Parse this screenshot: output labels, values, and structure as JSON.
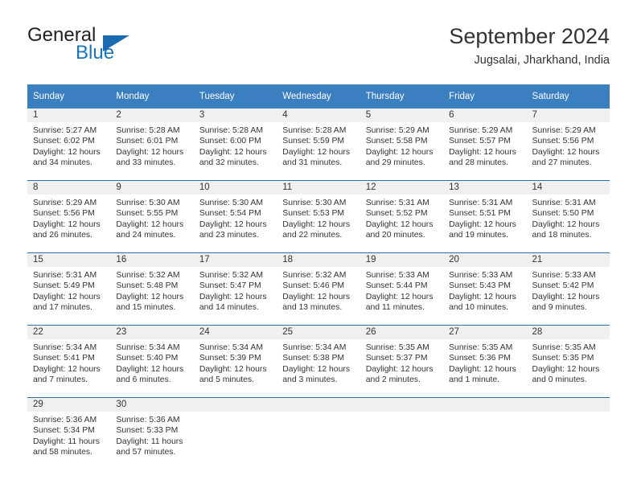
{
  "brand": {
    "name_top": "General",
    "name_bottom": "Blue",
    "triangle_icon": "blue-triangle-icon",
    "color_dark": "#231f20",
    "color_blue": "#1a74bb"
  },
  "header": {
    "title": "September 2024",
    "subtitle": "Jugsalai, Jharkhand, India"
  },
  "colors": {
    "header_band": "#3c7fc1",
    "row_divider": "#2e6fb0",
    "daynum_band": "#f0f0f0",
    "text": "#333333"
  },
  "weekdays": [
    "Sunday",
    "Monday",
    "Tuesday",
    "Wednesday",
    "Thursday",
    "Friday",
    "Saturday"
  ],
  "weeks": [
    [
      {
        "day": "1",
        "sunrise": "Sunrise: 5:27 AM",
        "sunset": "Sunset: 6:02 PM",
        "daylight1": "Daylight: 12 hours",
        "daylight2": "and 34 minutes."
      },
      {
        "day": "2",
        "sunrise": "Sunrise: 5:28 AM",
        "sunset": "Sunset: 6:01 PM",
        "daylight1": "Daylight: 12 hours",
        "daylight2": "and 33 minutes."
      },
      {
        "day": "3",
        "sunrise": "Sunrise: 5:28 AM",
        "sunset": "Sunset: 6:00 PM",
        "daylight1": "Daylight: 12 hours",
        "daylight2": "and 32 minutes."
      },
      {
        "day": "4",
        "sunrise": "Sunrise: 5:28 AM",
        "sunset": "Sunset: 5:59 PM",
        "daylight1": "Daylight: 12 hours",
        "daylight2": "and 31 minutes."
      },
      {
        "day": "5",
        "sunrise": "Sunrise: 5:29 AM",
        "sunset": "Sunset: 5:58 PM",
        "daylight1": "Daylight: 12 hours",
        "daylight2": "and 29 minutes."
      },
      {
        "day": "6",
        "sunrise": "Sunrise: 5:29 AM",
        "sunset": "Sunset: 5:57 PM",
        "daylight1": "Daylight: 12 hours",
        "daylight2": "and 28 minutes."
      },
      {
        "day": "7",
        "sunrise": "Sunrise: 5:29 AM",
        "sunset": "Sunset: 5:56 PM",
        "daylight1": "Daylight: 12 hours",
        "daylight2": "and 27 minutes."
      }
    ],
    [
      {
        "day": "8",
        "sunrise": "Sunrise: 5:29 AM",
        "sunset": "Sunset: 5:56 PM",
        "daylight1": "Daylight: 12 hours",
        "daylight2": "and 26 minutes."
      },
      {
        "day": "9",
        "sunrise": "Sunrise: 5:30 AM",
        "sunset": "Sunset: 5:55 PM",
        "daylight1": "Daylight: 12 hours",
        "daylight2": "and 24 minutes."
      },
      {
        "day": "10",
        "sunrise": "Sunrise: 5:30 AM",
        "sunset": "Sunset: 5:54 PM",
        "daylight1": "Daylight: 12 hours",
        "daylight2": "and 23 minutes."
      },
      {
        "day": "11",
        "sunrise": "Sunrise: 5:30 AM",
        "sunset": "Sunset: 5:53 PM",
        "daylight1": "Daylight: 12 hours",
        "daylight2": "and 22 minutes."
      },
      {
        "day": "12",
        "sunrise": "Sunrise: 5:31 AM",
        "sunset": "Sunset: 5:52 PM",
        "daylight1": "Daylight: 12 hours",
        "daylight2": "and 20 minutes."
      },
      {
        "day": "13",
        "sunrise": "Sunrise: 5:31 AM",
        "sunset": "Sunset: 5:51 PM",
        "daylight1": "Daylight: 12 hours",
        "daylight2": "and 19 minutes."
      },
      {
        "day": "14",
        "sunrise": "Sunrise: 5:31 AM",
        "sunset": "Sunset: 5:50 PM",
        "daylight1": "Daylight: 12 hours",
        "daylight2": "and 18 minutes."
      }
    ],
    [
      {
        "day": "15",
        "sunrise": "Sunrise: 5:31 AM",
        "sunset": "Sunset: 5:49 PM",
        "daylight1": "Daylight: 12 hours",
        "daylight2": "and 17 minutes."
      },
      {
        "day": "16",
        "sunrise": "Sunrise: 5:32 AM",
        "sunset": "Sunset: 5:48 PM",
        "daylight1": "Daylight: 12 hours",
        "daylight2": "and 15 minutes."
      },
      {
        "day": "17",
        "sunrise": "Sunrise: 5:32 AM",
        "sunset": "Sunset: 5:47 PM",
        "daylight1": "Daylight: 12 hours",
        "daylight2": "and 14 minutes."
      },
      {
        "day": "18",
        "sunrise": "Sunrise: 5:32 AM",
        "sunset": "Sunset: 5:46 PM",
        "daylight1": "Daylight: 12 hours",
        "daylight2": "and 13 minutes."
      },
      {
        "day": "19",
        "sunrise": "Sunrise: 5:33 AM",
        "sunset": "Sunset: 5:44 PM",
        "daylight1": "Daylight: 12 hours",
        "daylight2": "and 11 minutes."
      },
      {
        "day": "20",
        "sunrise": "Sunrise: 5:33 AM",
        "sunset": "Sunset: 5:43 PM",
        "daylight1": "Daylight: 12 hours",
        "daylight2": "and 10 minutes."
      },
      {
        "day": "21",
        "sunrise": "Sunrise: 5:33 AM",
        "sunset": "Sunset: 5:42 PM",
        "daylight1": "Daylight: 12 hours",
        "daylight2": "and 9 minutes."
      }
    ],
    [
      {
        "day": "22",
        "sunrise": "Sunrise: 5:34 AM",
        "sunset": "Sunset: 5:41 PM",
        "daylight1": "Daylight: 12 hours",
        "daylight2": "and 7 minutes."
      },
      {
        "day": "23",
        "sunrise": "Sunrise: 5:34 AM",
        "sunset": "Sunset: 5:40 PM",
        "daylight1": "Daylight: 12 hours",
        "daylight2": "and 6 minutes."
      },
      {
        "day": "24",
        "sunrise": "Sunrise: 5:34 AM",
        "sunset": "Sunset: 5:39 PM",
        "daylight1": "Daylight: 12 hours",
        "daylight2": "and 5 minutes."
      },
      {
        "day": "25",
        "sunrise": "Sunrise: 5:34 AM",
        "sunset": "Sunset: 5:38 PM",
        "daylight1": "Daylight: 12 hours",
        "daylight2": "and 3 minutes."
      },
      {
        "day": "26",
        "sunrise": "Sunrise: 5:35 AM",
        "sunset": "Sunset: 5:37 PM",
        "daylight1": "Daylight: 12 hours",
        "daylight2": "and 2 minutes."
      },
      {
        "day": "27",
        "sunrise": "Sunrise: 5:35 AM",
        "sunset": "Sunset: 5:36 PM",
        "daylight1": "Daylight: 12 hours",
        "daylight2": "and 1 minute."
      },
      {
        "day": "28",
        "sunrise": "Sunrise: 5:35 AM",
        "sunset": "Sunset: 5:35 PM",
        "daylight1": "Daylight: 12 hours",
        "daylight2": "and 0 minutes."
      }
    ],
    [
      {
        "day": "29",
        "sunrise": "Sunrise: 5:36 AM",
        "sunset": "Sunset: 5:34 PM",
        "daylight1": "Daylight: 11 hours",
        "daylight2": "and 58 minutes."
      },
      {
        "day": "30",
        "sunrise": "Sunrise: 5:36 AM",
        "sunset": "Sunset: 5:33 PM",
        "daylight1": "Daylight: 11 hours",
        "daylight2": "and 57 minutes."
      },
      {
        "day": "",
        "sunrise": "",
        "sunset": "",
        "daylight1": "",
        "daylight2": ""
      },
      {
        "day": "",
        "sunrise": "",
        "sunset": "",
        "daylight1": "",
        "daylight2": ""
      },
      {
        "day": "",
        "sunrise": "",
        "sunset": "",
        "daylight1": "",
        "daylight2": ""
      },
      {
        "day": "",
        "sunrise": "",
        "sunset": "",
        "daylight1": "",
        "daylight2": ""
      },
      {
        "day": "",
        "sunrise": "",
        "sunset": "",
        "daylight1": "",
        "daylight2": ""
      }
    ]
  ]
}
